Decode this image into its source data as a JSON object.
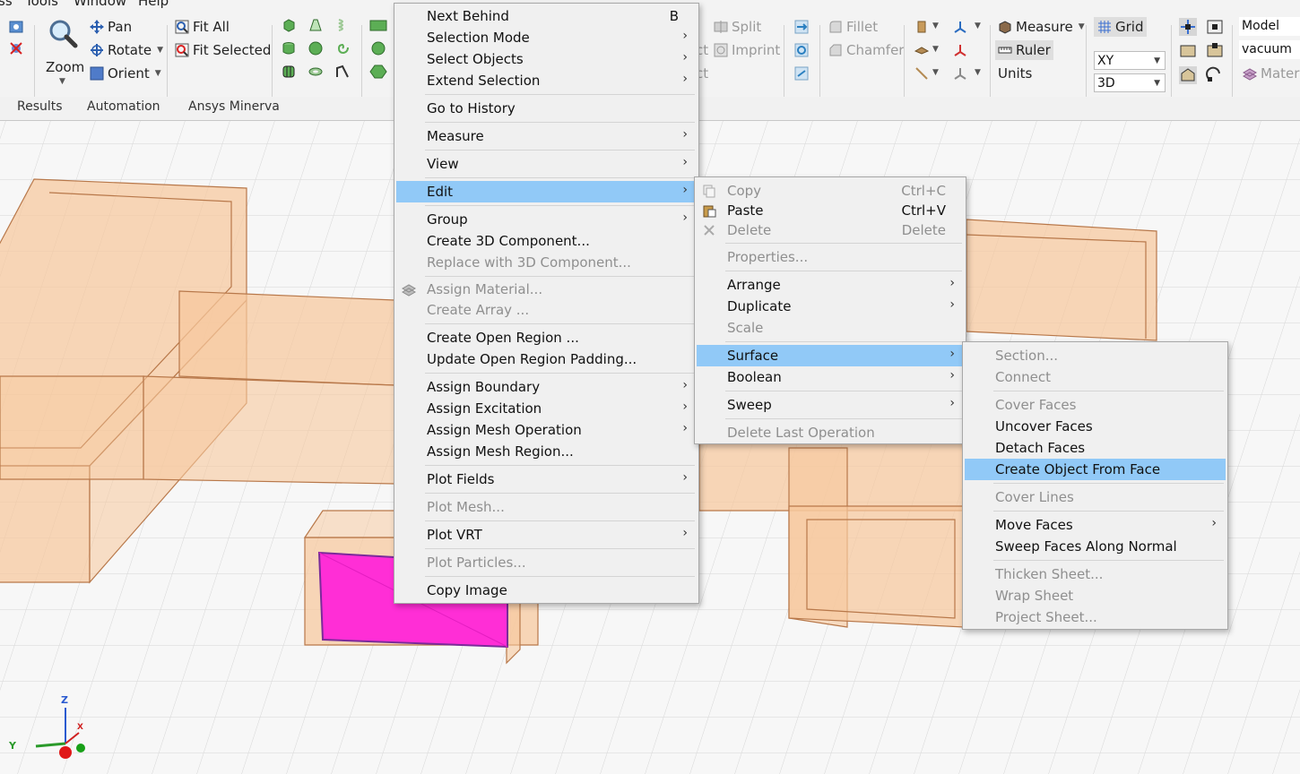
{
  "menubar": [
    "ss",
    "Tools",
    "Window",
    "Help"
  ],
  "ribbon": {
    "zoom": "Zoom",
    "pan": "Pan",
    "rotate": "Rotate",
    "orient": "Orient",
    "fit_all": "Fit All",
    "fit_selected": "Fit Selected",
    "split": "Split",
    "imprint": "Imprint",
    "ct1": "ct",
    "ct2": "ct",
    "fillet": "Fillet",
    "chamfer": "Chamfer",
    "measure": "Measure",
    "ruler": "Ruler",
    "units": "Units",
    "grid": "Grid",
    "plane": "XY",
    "mode": "3D",
    "model": "Model",
    "material": "vacuum",
    "mater": "Mater"
  },
  "ribbon_tabs": [
    "Results",
    "Automation",
    "Ansys Minerva"
  ],
  "context_menu": {
    "items": [
      {
        "label": "Next Behind",
        "shortcut": "B"
      },
      {
        "label": "Selection Mode"
      },
      {
        "label": "Select Objects"
      },
      {
        "label": "Extend Selection"
      },
      {
        "label": "Go to History"
      },
      {
        "label": "Measure"
      },
      {
        "label": "View"
      },
      {
        "label": "Edit"
      },
      {
        "label": "Group"
      },
      {
        "label": "Create 3D Component..."
      },
      {
        "label": "Replace with 3D Component..."
      },
      {
        "label": "Assign Material..."
      },
      {
        "label": "Create Array ..."
      },
      {
        "label": "Create Open Region ..."
      },
      {
        "label": "Update Open Region Padding..."
      },
      {
        "label": "Assign Boundary"
      },
      {
        "label": "Assign Excitation"
      },
      {
        "label": "Assign Mesh Operation"
      },
      {
        "label": "Assign Mesh Region..."
      },
      {
        "label": "Plot Fields"
      },
      {
        "label": "Plot Mesh..."
      },
      {
        "label": "Plot VRT"
      },
      {
        "label": "Plot Particles..."
      },
      {
        "label": "Copy Image"
      }
    ]
  },
  "edit_submenu": {
    "items": [
      {
        "label": "Copy",
        "shortcut": "Ctrl+C"
      },
      {
        "label": "Paste",
        "shortcut": "Ctrl+V"
      },
      {
        "label": "Delete",
        "shortcut": "Delete"
      },
      {
        "label": "Properties..."
      },
      {
        "label": "Arrange"
      },
      {
        "label": "Duplicate"
      },
      {
        "label": "Scale"
      },
      {
        "label": "Surface"
      },
      {
        "label": "Boolean"
      },
      {
        "label": "Sweep"
      },
      {
        "label": "Delete Last Operation"
      }
    ]
  },
  "surface_submenu": {
    "items": [
      {
        "label": "Section..."
      },
      {
        "label": "Connect"
      },
      {
        "label": "Cover Faces"
      },
      {
        "label": "Uncover Faces"
      },
      {
        "label": "Detach Faces"
      },
      {
        "label": "Create Object From Face"
      },
      {
        "label": "Cover Lines"
      },
      {
        "label": "Move Faces"
      },
      {
        "label": "Sweep Faces Along Normal"
      },
      {
        "label": "Thicken Sheet..."
      },
      {
        "label": "Wrap Sheet"
      },
      {
        "label": "Project Sheet..."
      }
    ]
  },
  "axes": {
    "z": "Z",
    "x": "X",
    "y": "Y"
  },
  "colors": {
    "highlight": "#91c9f7",
    "object_fill": "#f7c89c",
    "object_edge": "#b8784a",
    "selected_face": "#ff2ed6",
    "grid_line": "#d5d5d5"
  }
}
